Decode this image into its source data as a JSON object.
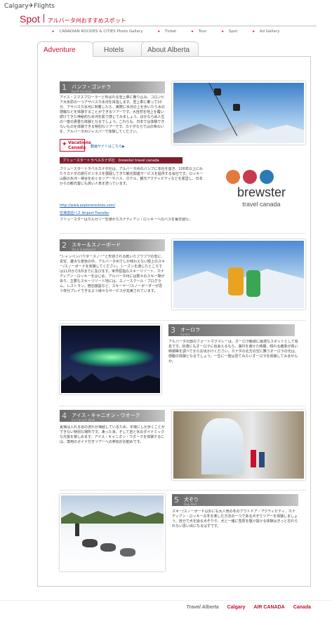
{
  "header": {
    "brand": "Calgary✈Flights",
    "spot_title": "Spot",
    "spot_subtitle": "アルバータ州おすすめスポット"
  },
  "nav": [
    {
      "label": "CANADIAN ROCKIES & CITIES Photo Gallery"
    },
    {
      "label": "Ticket"
    },
    {
      "label": "Tour"
    },
    {
      "label": "Spot"
    },
    {
      "label": "Ad Gallery"
    }
  ],
  "tabs": [
    {
      "label": "Adventure",
      "active": true
    },
    {
      "label": "Hotels",
      "active": false
    },
    {
      "label": "About Alberta",
      "active": false
    }
  ],
  "sections": [
    {
      "num": "1",
      "title": "バンフ・ゴンドラ",
      "en": "Banff Gondola",
      "body": "アイス・エクスプローラーと呼ばれる雪上車に乗り込み、コロンビア大氷原の一つアサバスカ氷河を目指します。雪上車に乗って10分、アサバスカ氷河に到着したら、実際に氷河の上を歩いたり水の感触などを体験することができるツアーです。大自然を地上を覆い続けてきた神秘的な氷河を肌で感じてみましょう。ほかならぬ人生の一度の貴重な体験となるでしょう。これらも、日本では体験できないものを体験できる特別なツアーです。カナダならではの味わいを、アルバータ州ジャスパーで体験してください。"
    },
    {
      "num": "2",
      "title": "スキー＆スノーボード",
      "en": "Ski & Snowboard",
      "body": "\"シャンペンパウダースノー\"と形容される乾いたフワフワの雪に、青空、雄大な景色の中、アルバータ州でしか味わえない極上のスキー/スノーボードを体験してください。シーズンを通じたところでは11月から5月までに及びます。世界屈指のスキーリゾート、カナディアン・ロッキーをはじめ、アルバータ州には数々のスキー場があり、主要なスキーリゾート地には、スノースクール・プログラム、レストラン、宿泊施設など、スキーヤー/スノーボーダーが思う存分プレイできるよう様々なサービスが充実されています。"
    },
    {
      "num": "3",
      "title": "オーロラ",
      "en": "Aurora",
      "body": "アルバータ北部のフォートマクマレーは、オーロラ観測に最適なスポットとして有名です。好適にもオーロラに出会えるなら、満月を避けた時期、晴れる確率が高い時期等を調べてからお出かけください。カナダの北方の空に舞うオーロラの光は、感動の体験となるでしょう。一生に一度は見てみたいオーロラを体験してみませんか。"
    },
    {
      "num": "4",
      "title": "アイス・キャニオン・ウオーク",
      "en": "Ice Canyon Walk",
      "body": "夏場は入れる谷の流れが凍結しているため、冬場にしか歩くことができない特別な場所です。凍った滝、そして岩と氷のダイナミックな光景を楽しめます。アイス・キャニオン・ウオークを体験するには、専用のガイド付きツアーへの参加がお勧めです。"
    },
    {
      "num": "5",
      "title": "犬ぞり",
      "en": "Dog Sled",
      "body": "スキー/スノーボード以外にも大人気の冬のアウトドア・アクティビティ、カナディアン・ロッキーの冬を楽しむ方法の一つである犬ぞりツアーを体験しましょう。自分で犬を操る犬ぞりや、犬と一緒に雪原を駆け抜ける体験はきっと忘れられない思い出になるはずです。"
    }
  ],
  "vacations": {
    "logo_line1": "Vacations",
    "logo_line2": "Canada",
    "link": "動画サイトはこちら▶"
  },
  "brewster": {
    "bar": "ブリュースタートラベルカナダ社　brewster travel canada",
    "text": "ブリュースタートラベルカナダ社は、アルバータ州のバンフに本社を置き、100年以上にわたりカナダの旅行ビジネスを展開してきた観光関連サービスを提供する会社です。ロッキー山脈の氷河・峡谷をめぐるツアーやバス、ホテル、観光アクティビティなどを運営し、日本からの観光客にも高い人気を誇っています。",
    "link1": "http://www.explorerockies.com/",
    "link2": "空港送迎バス Airport Transfer",
    "text2": "ブリュースターはカルガリー空港からカナディアン・ロッキーへのバスを毎日運行。",
    "word": "brewster",
    "sub": "travel canada"
  },
  "footer": [
    "Travel Alberta",
    "Calgary",
    "AIR CANADA",
    "Canada"
  ]
}
